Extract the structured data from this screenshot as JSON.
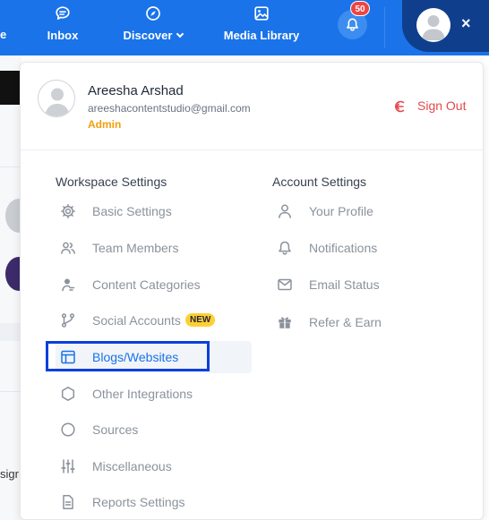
{
  "topnav": {
    "edge_text": "e",
    "items": [
      {
        "label": "Inbox",
        "icon": "chat-bubble-icon"
      },
      {
        "label": "Discover",
        "icon": "compass-icon"
      },
      {
        "label": "Media Library",
        "icon": "image-icon"
      }
    ],
    "notifications_count": "50",
    "close_symbol": "×"
  },
  "background": {
    "partial_text": "sigr"
  },
  "user": {
    "name": "Areesha Arshad",
    "email": "areeshacontentstudio@gmail.com",
    "role": "Admin",
    "signout_label": "Sign Out"
  },
  "workspace_settings": {
    "heading": "Workspace Settings",
    "items": [
      {
        "label": "Basic Settings",
        "icon": "gear-icon"
      },
      {
        "label": "Team Members",
        "icon": "users-icon"
      },
      {
        "label": "Content Categories",
        "icon": "user-tag-icon"
      },
      {
        "label": "Social Accounts",
        "icon": "branch-icon",
        "badge": "NEW"
      },
      {
        "label": "Blogs/Websites",
        "icon": "layout-icon",
        "active": true
      },
      {
        "label": "Other Integrations",
        "icon": "hexagon-icon"
      },
      {
        "label": "Sources",
        "icon": "circle-icon"
      },
      {
        "label": "Miscellaneous",
        "icon": "sliders-icon"
      },
      {
        "label": "Reports Settings",
        "icon": "document-icon"
      }
    ]
  },
  "account_settings": {
    "heading": "Account Settings",
    "items": [
      {
        "label": "Your Profile",
        "icon": "user-icon"
      },
      {
        "label": "Notifications",
        "icon": "bell-icon"
      },
      {
        "label": "Email Status",
        "icon": "mail-icon"
      },
      {
        "label": "Refer & Earn",
        "icon": "gift-icon"
      }
    ]
  },
  "colors": {
    "nav_bg": "#1a73e8",
    "profile_toggle_bg": "#0f3f8c",
    "active_link": "#1a73e8",
    "signout": "#e5484d",
    "role": "#f59e0b",
    "badge_new": "#ffcf33",
    "notif_badge": "#ef4444",
    "highlight_border": "#0a3fdc"
  }
}
